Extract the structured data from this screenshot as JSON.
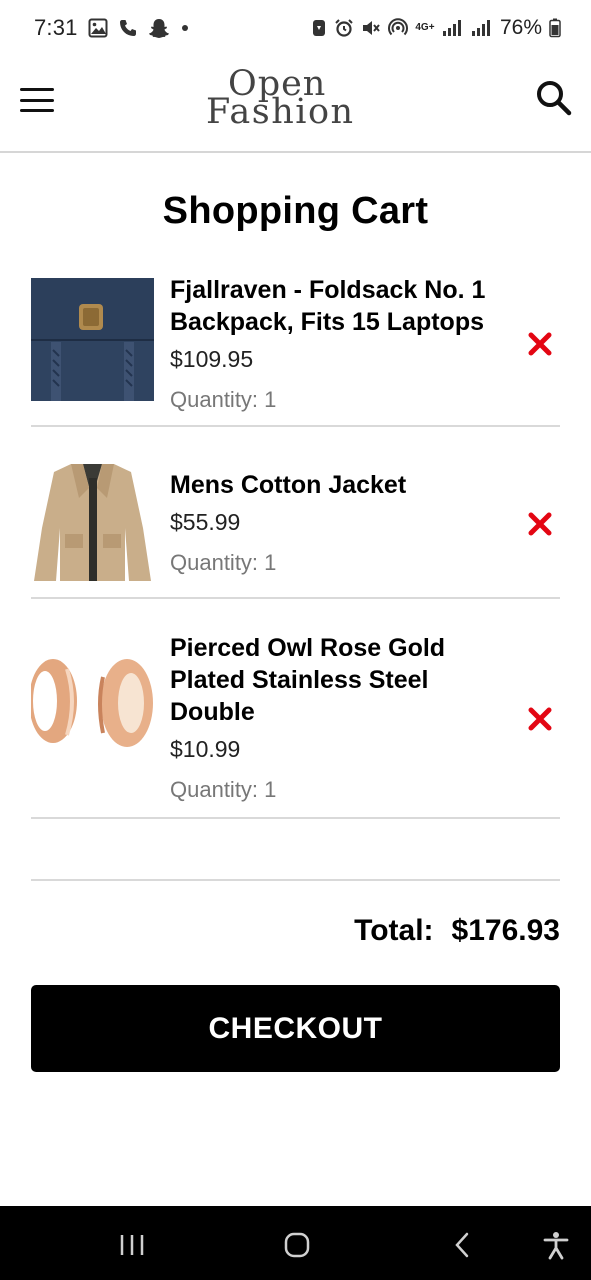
{
  "status_bar": {
    "time": "7:31",
    "battery": "76%",
    "network": "4G+"
  },
  "header": {
    "logo_line1": "Open",
    "logo_line2": "Fashion"
  },
  "page": {
    "title": "Shopping Cart"
  },
  "cart": {
    "quantity_label": "Quantity:",
    "items": [
      {
        "title": "Fjallraven - Foldsack No. 1 Backpack, Fits 15 Laptops",
        "price": "$109.95",
        "quantity": "1",
        "image": "backpack"
      },
      {
        "title": "Mens Cotton Jacket",
        "price": "$55.99",
        "quantity": "1",
        "image": "jacket"
      },
      {
        "title": "Pierced Owl Rose Gold Plated Stainless Steel Double",
        "price": "$10.99",
        "quantity": "1",
        "image": "rose-gold-rings"
      }
    ],
    "total_label": "Total:",
    "total_value": "$176.93",
    "checkout_label": "CHECKOUT"
  },
  "colors": {
    "remove": "#e30613",
    "checkout_bg": "#000000",
    "divider": "#d9d9d9"
  },
  "icons": [
    "menu-icon",
    "search-icon",
    "remove-icon",
    "recent-apps-icon",
    "home-icon",
    "back-icon",
    "accessibility-icon"
  ]
}
